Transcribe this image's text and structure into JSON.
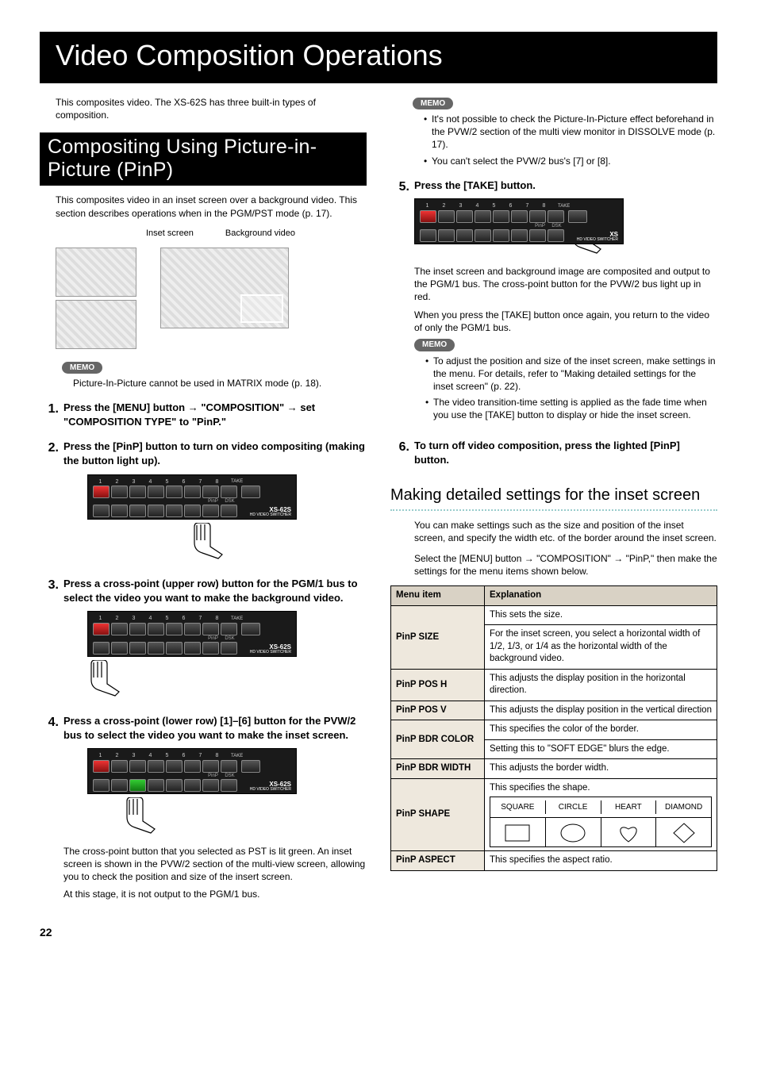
{
  "page_title": "Video Composition Operations",
  "intro": "This composites video. The XS-62S has three built-in types of composition.",
  "section1_title": "Compositing Using Picture-in-Picture (PinP)",
  "section1_intro": "This composites video in an inset screen over a background video. This section describes operations when in the PGM/PST mode (p. 17).",
  "inset_label": "Inset screen",
  "bg_label": "Background video",
  "memo_label": "MEMO",
  "memo1_text": "Picture-In-Picture cannot be used in MATRIX mode (p. 18).",
  "step1_num": "1.",
  "step1_head_a": "Press the [MENU] button ",
  "step1_head_b": " \"COMPOSITION\" ",
  "step1_head_c": " set \"COMPOSITION TYPE\" to \"PinP.\"",
  "step2_num": "2.",
  "step2_head": "Press the [PinP] button to turn on video compositing (making the button light up).",
  "step3_num": "3.",
  "step3_head": "Press a cross-point (upper row) button for the PGM/1 bus to select the video you want to make the background video.",
  "step4_num": "4.",
  "step4_head": "Press a cross-point (lower row) [1]–[6] button for the PVW/2 bus to select the video you want to make the inset screen.",
  "step4_text1": "The cross-point button that you selected as PST is lit green. An inset screen is shown in the PVW/2 section of the multi-view screen, allowing you to check the position and size of the insert screen.",
  "step4_text2": "At this stage, it is not output to the PGM/1 bus.",
  "memo2_b1": "It's not possible to check the Picture-In-Picture effect beforehand in the PVW/2 section of the multi view monitor in DISSOLVE mode (p. 17).",
  "memo2_b2": "You can't select the PVW/2 bus's [7] or [8].",
  "step5_num": "5.",
  "step5_head": "Press the [TAKE] button.",
  "step5_text1": "The inset screen and background image are composited and output to the PGM/1 bus. The cross-point button for the PVW/2 bus light up in red.",
  "step5_text2": "When you press the [TAKE] button once again, you return to the video of only the PGM/1 bus.",
  "memo3_b1": "To adjust the position and size of the inset screen, make settings in the menu. For details, refer to \"Making detailed settings for the inset screen\" (p. 22).",
  "memo3_b2": "The video transition-time setting is applied as the fade time when you use the [TAKE] button to display or hide the inset screen.",
  "step6_num": "6.",
  "step6_head": "To turn off video composition, press the lighted [PinP] button.",
  "sub_heading": "Making detailed settings for the inset screen",
  "sub_intro1": "You can make settings such as the size and position of the inset screen, and specify the width etc. of the border around the inset screen.",
  "sub_intro2a": "Select the [MENU] button ",
  "sub_intro2b": " \"COMPOSITION\" ",
  "sub_intro2c": " \"PinP,\" then make the settings for the menu items shown below.",
  "th_menu": "Menu item",
  "th_exp": "Explanation",
  "r1_mi": "PinP SIZE",
  "r1_e1": "This sets the size.",
  "r1_e2": "For the inset screen, you select a horizontal width of 1/2, 1/3, or 1/4 as the horizontal width of the background video.",
  "r2_mi": "PinP POS H",
  "r2_e": "This adjusts the display position in the horizontal direction.",
  "r3_mi": "PinP POS V",
  "r3_e": "This adjusts the display position in the vertical direction",
  "r4_mi": "PinP BDR COLOR",
  "r4_e1": "This specifies the color of the border.",
  "r4_e2": "Setting this to \"SOFT EDGE\" blurs the edge.",
  "r5_mi": "PinP BDR WIDTH",
  "r5_e": "This adjusts the border width.",
  "r6_mi": "PinP SHAPE",
  "r6_e": "This specifies the shape.",
  "shape1": "SQUARE",
  "shape2": "CIRCLE",
  "shape3": "HEART",
  "shape4": "DIAMOND",
  "r7_mi": "PinP ASPECT",
  "r7_e": "This specifies the aspect ratio.",
  "panel_brand": "XS-62S",
  "panel_brand_sub": "HD VIDEO SWITCHER",
  "pinp_lbl": "PinP",
  "dsk_lbl": "DSK",
  "take_text": "TAKE",
  "page_num": "22",
  "arrow_char": "→"
}
